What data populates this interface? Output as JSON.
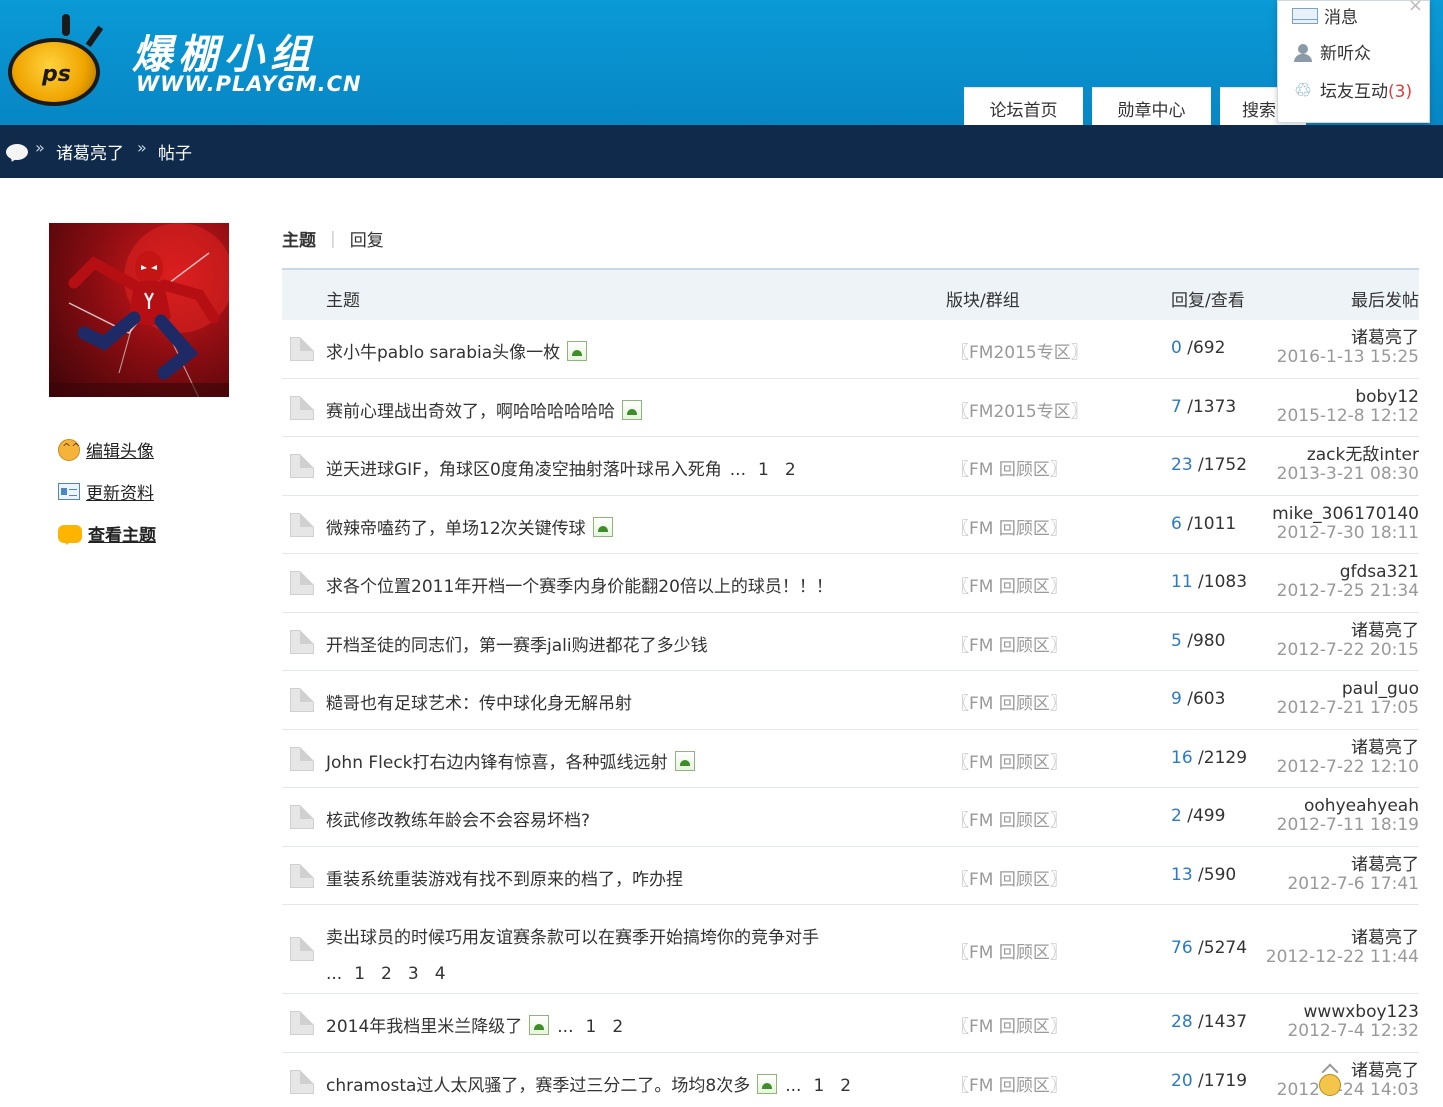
{
  "header": {
    "logo_cn": "爆棚小组",
    "logo_url": "WWW.PLAYGM.CN",
    "logo_badge": "ps",
    "nav_tabs": [
      "论坛首页",
      "勋章中心",
      "搜索"
    ]
  },
  "popup": {
    "close": "×",
    "messages": "消息",
    "new_listeners": "新听众",
    "interaction_label": "坛友互动",
    "interaction_count": "(3)"
  },
  "breadcrumb": {
    "sep": "»",
    "user": "诸葛亮了",
    "page": "帖子"
  },
  "sidebar": {
    "edit_avatar": "编辑头像",
    "update_profile": "更新资料",
    "view_topics": "查看主题"
  },
  "tabs": {
    "topics": "主题",
    "sep": "|",
    "replies": "回复"
  },
  "table": {
    "headers": {
      "topic": "主题",
      "forum": "版块/群组",
      "stats": "回复/查看",
      "last": "最后发帖"
    },
    "rows": [
      {
        "title": "求小牛pablo sarabia头像一枚",
        "img": true,
        "forum": "〖FM2015专区〗",
        "replies": "0",
        "views": "/692",
        "user": "诸葛亮了",
        "time": "2016-1-13 15:25"
      },
      {
        "title": "赛前心理战出奇效了，啊哈哈哈哈哈哈",
        "img": true,
        "forum": "〖FM2015专区〗",
        "replies": "7",
        "views": "/1373",
        "user": "boby12",
        "time": "2015-12-8 12:12"
      },
      {
        "title": "逆天进球GIF，角球区0度角凌空抽射落叶球吊入死角",
        "img": false,
        "ellipsis": "...",
        "pages": [
          "1",
          "2"
        ],
        "forum": "〖FM 回顾区〗",
        "replies": "23",
        "views": "/1752",
        "user": "zack无敌inter",
        "time": "2013-3-21 08:30"
      },
      {
        "title": "微辣帝嗑药了，单场12次关键传球",
        "img": true,
        "forum": "〖FM 回顾区〗",
        "replies": "6",
        "views": "/1011",
        "user": "mike_306170140",
        "time": "2012-7-30 18:11"
      },
      {
        "title": "求各个位置2011年开档一个赛季内身价能翻20倍以上的球员！！！",
        "img": false,
        "forum": "〖FM 回顾区〗",
        "replies": "11",
        "views": "/1083",
        "user": "gfdsa321",
        "time": "2012-7-25 21:34"
      },
      {
        "title": "开档圣徒的同志们，第一赛季jali购进都花了多少钱",
        "img": false,
        "forum": "〖FM 回顾区〗",
        "replies": "5",
        "views": "/980",
        "user": "诸葛亮了",
        "time": "2012-7-22 20:15"
      },
      {
        "title": "糙哥也有足球艺术：传中球化身无解吊射",
        "img": false,
        "forum": "〖FM 回顾区〗",
        "replies": "9",
        "views": "/603",
        "user": "paul_guo",
        "time": "2012-7-21 17:05"
      },
      {
        "title": "John Fleck打右边内锋有惊喜，各种弧线远射",
        "img": true,
        "forum": "〖FM 回顾区〗",
        "replies": "16",
        "views": "/2129",
        "user": "诸葛亮了",
        "time": "2012-7-22 12:10"
      },
      {
        "title": "核武修改教练年龄会不会容易坏档?",
        "img": false,
        "forum": "〖FM 回顾区〗",
        "replies": "2",
        "views": "/499",
        "user": "oohyeahyeah",
        "time": "2012-7-11 18:19"
      },
      {
        "title": "重装系统重装游戏有找不到原来的档了，咋办捏",
        "img": false,
        "forum": "〖FM 回顾区〗",
        "replies": "13",
        "views": "/590",
        "user": "诸葛亮了",
        "time": "2012-7-6 17:41"
      },
      {
        "title": "卖出球员的时候巧用友谊赛条款可以在赛季开始搞垮你的竞争对手",
        "img": false,
        "ellipsis": "...",
        "pages": [
          "1",
          "2",
          "3",
          "4"
        ],
        "wrap": true,
        "forum": "〖FM 回顾区〗",
        "replies": "76",
        "views": "/5274",
        "user": "诸葛亮了",
        "time": "2012-12-22 11:44"
      },
      {
        "title": "2014年我档里米兰降级了",
        "img": true,
        "ellipsis": "...",
        "pages": [
          "1",
          "2"
        ],
        "forum": "〖FM 回顾区〗",
        "replies": "28",
        "views": "/1437",
        "user": "wwwxboy123",
        "time": "2012-7-4 12:32"
      },
      {
        "title": "chramosta过人太风骚了，赛季过三分二了。场均8次多",
        "img": true,
        "ellipsis": "...",
        "pages": [
          "1",
          "2"
        ],
        "forum": "〖FM 回顾区〗",
        "replies": "20",
        "views": "/1719",
        "user": "诸葛亮了",
        "time": "2012-6-24 14:03"
      }
    ]
  }
}
